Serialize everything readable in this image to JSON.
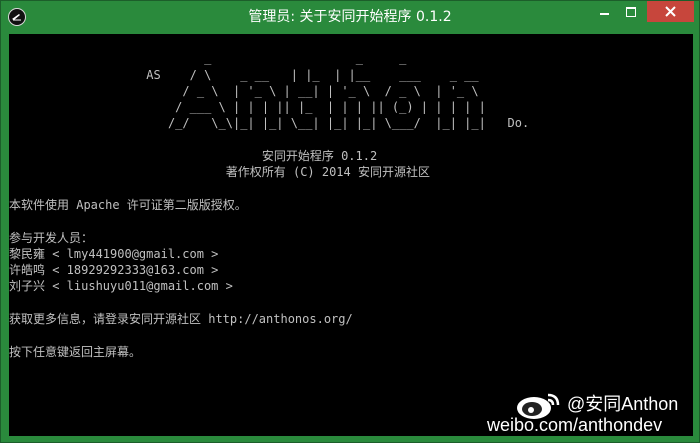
{
  "window": {
    "title": "管理员: 关于安同开始程序 0.1.2"
  },
  "console": {
    "lines": [
      "",
      "                           _                    _     _",
      "                   AS    / \\    _ __   | |_  | |__    ___    _ __",
      "                        / _ \\  | '_ \\ | __| | '_ \\  / _ \\  | '_ \\",
      "                       / ___ \\ | | | || |_  | | | || (_) | | | | |",
      "                      /_/   \\_\\|_| |_| \\__| |_| |_| \\___/  |_| |_|   Do.",
      "",
      "                                   安同开始程序 0.1.2",
      "                              著作权所有 (C) 2014 安同开源社区",
      "",
      "本软件使用 Apache 许可证第二版版授权。",
      "",
      "参与开发人员：",
      "黎民雍 < lmy441900@gmail.com >",
      "许皓鸣 < 18929292333@163.com >",
      "刘子兴 < liushuyu011@gmail.com >",
      "",
      "获取更多信息，请登录安同开源社区 http://anthonos.org/",
      "",
      "按下任意键返回主屏幕。"
    ]
  },
  "watermark": {
    "handle": "@安同Anthon",
    "url": "weibo.com/anthondev"
  }
}
